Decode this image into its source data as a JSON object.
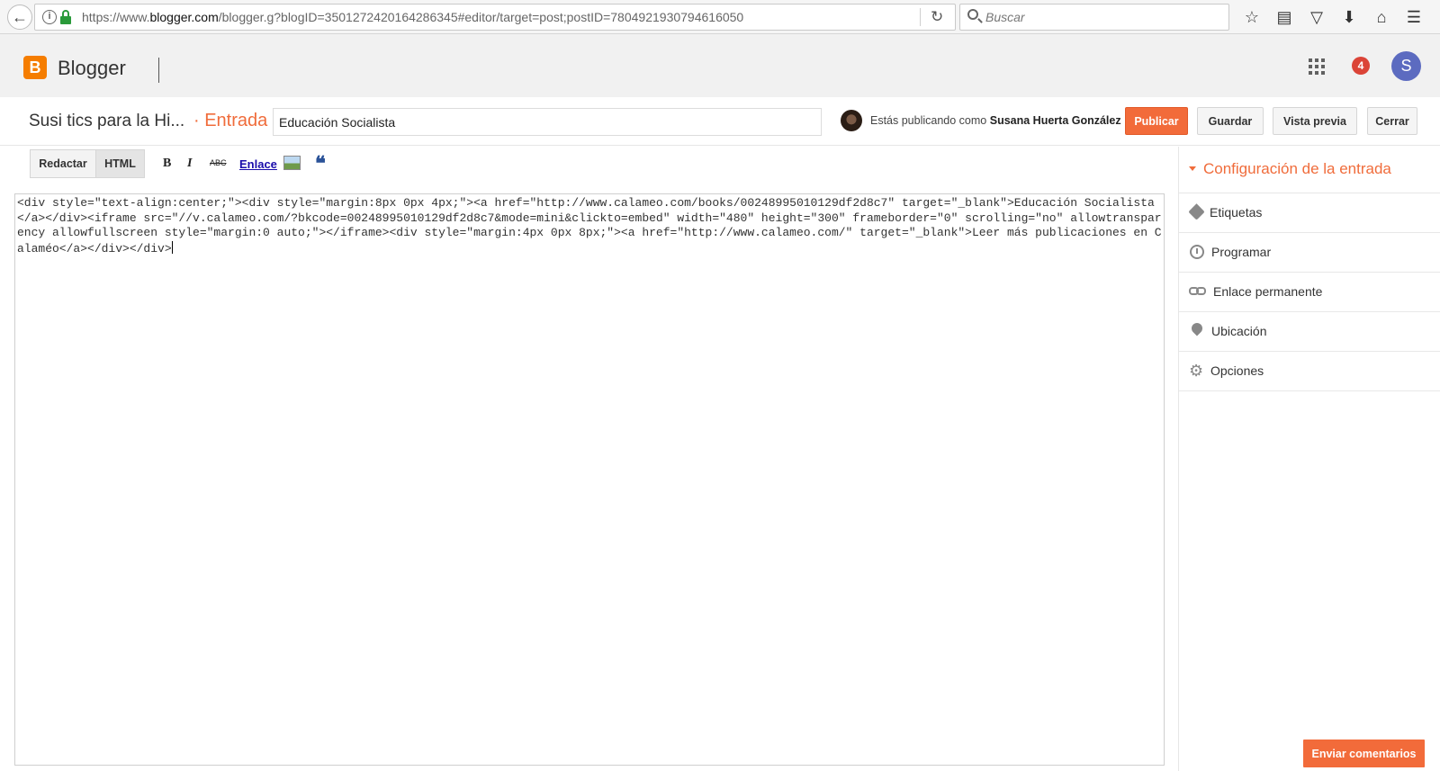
{
  "browser": {
    "url_prefix": "https://www.",
    "url_domain": "blogger.com",
    "url_path": "/blogger.g?blogID=3501272420164286345#editor/target=post;postID=7804921930794616050",
    "search_placeholder": "Buscar"
  },
  "app": {
    "name": "Blogger",
    "logo_letter": "B",
    "notification_count": "4",
    "user_initial": "S"
  },
  "post": {
    "blog_title": "Susi tics para la Hi...",
    "kind": "· Entrada",
    "title_value": "Educación Socialista",
    "publishing_as_label": "Estás publicando como",
    "author_name": "Susana Huerta González"
  },
  "actions": {
    "publish": "Publicar",
    "save": "Guardar",
    "preview": "Vista previa",
    "close": "Cerrar"
  },
  "editor": {
    "mode_compose": "Redactar",
    "mode_html": "HTML",
    "bold": "B",
    "italic": "I",
    "strike": "ABC",
    "link": "Enlace",
    "quote": "❝",
    "html_content": "<div style=\"text-align:center;\"><div style=\"margin:8px 0px 4px;\"><a href=\"http://www.calameo.com/books/00248995010129df2d8c7\" target=\"_blank\">Educación Socialista</a></div><iframe src=\"//v.calameo.com/?bkcode=00248995010129df2d8c7&mode=mini&clickto=embed\" width=\"480\" height=\"300\" frameborder=\"0\" scrolling=\"no\" allowtransparency allowfullscreen style=\"margin:0 auto;\"></iframe><div style=\"margin:4px 0px 8px;\"><a href=\"http://www.calameo.com/\" target=\"_blank\">Leer más publicaciones en Calaméo</a></div></div>"
  },
  "sidebar": {
    "title": "Configuración de la entrada",
    "items": [
      {
        "label": "Etiquetas",
        "icon": "tag-icon"
      },
      {
        "label": "Programar",
        "icon": "clock-icon"
      },
      {
        "label": "Enlace permanente",
        "icon": "link-icon"
      },
      {
        "label": "Ubicación",
        "icon": "location-pin-icon"
      },
      {
        "label": "Opciones",
        "icon": "gear-icon"
      }
    ]
  },
  "feedback": {
    "label": "Enviar comentarios"
  },
  "colors": {
    "accent": "#f26b3a",
    "notification": "#db4437",
    "avatar": "#5c6bc0",
    "logo": "#f57d00"
  }
}
